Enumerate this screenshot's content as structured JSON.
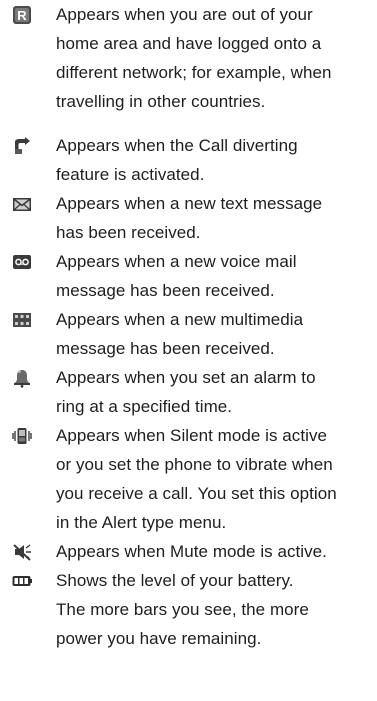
{
  "entries": [
    {
      "icon": "roaming-icon",
      "text": "Appears when you are out of your\nhome area and have logged onto a\ndifferent network; for example, when\ntravelling in other countries."
    },
    {
      "icon": "call-divert-icon",
      "text": "Appears when the Call diverting\nfeature is activated."
    },
    {
      "icon": "envelope-icon",
      "text": "Appears when a new text message\nhas been received."
    },
    {
      "icon": "voicemail-icon",
      "text": "Appears when a new voice mail\nmessage has been received."
    },
    {
      "icon": "multimedia-message-icon",
      "text": "Appears when a new multimedia\nmessage has been received."
    },
    {
      "icon": "alarm-bell-icon",
      "text": "Appears when you set an alarm to\nring at a specified time."
    },
    {
      "icon": "vibrate-icon",
      "text": "Appears when Silent mode is active\nor you set the phone to vibrate when\nyou receive a call. You set this option\nin the Alert type menu."
    },
    {
      "icon": "mute-icon",
      "text": "Appears when Mute mode is active."
    },
    {
      "icon": "battery-icon",
      "text": "Shows the level of your battery.\nThe more bars you see, the more\npower you have remaining."
    }
  ]
}
